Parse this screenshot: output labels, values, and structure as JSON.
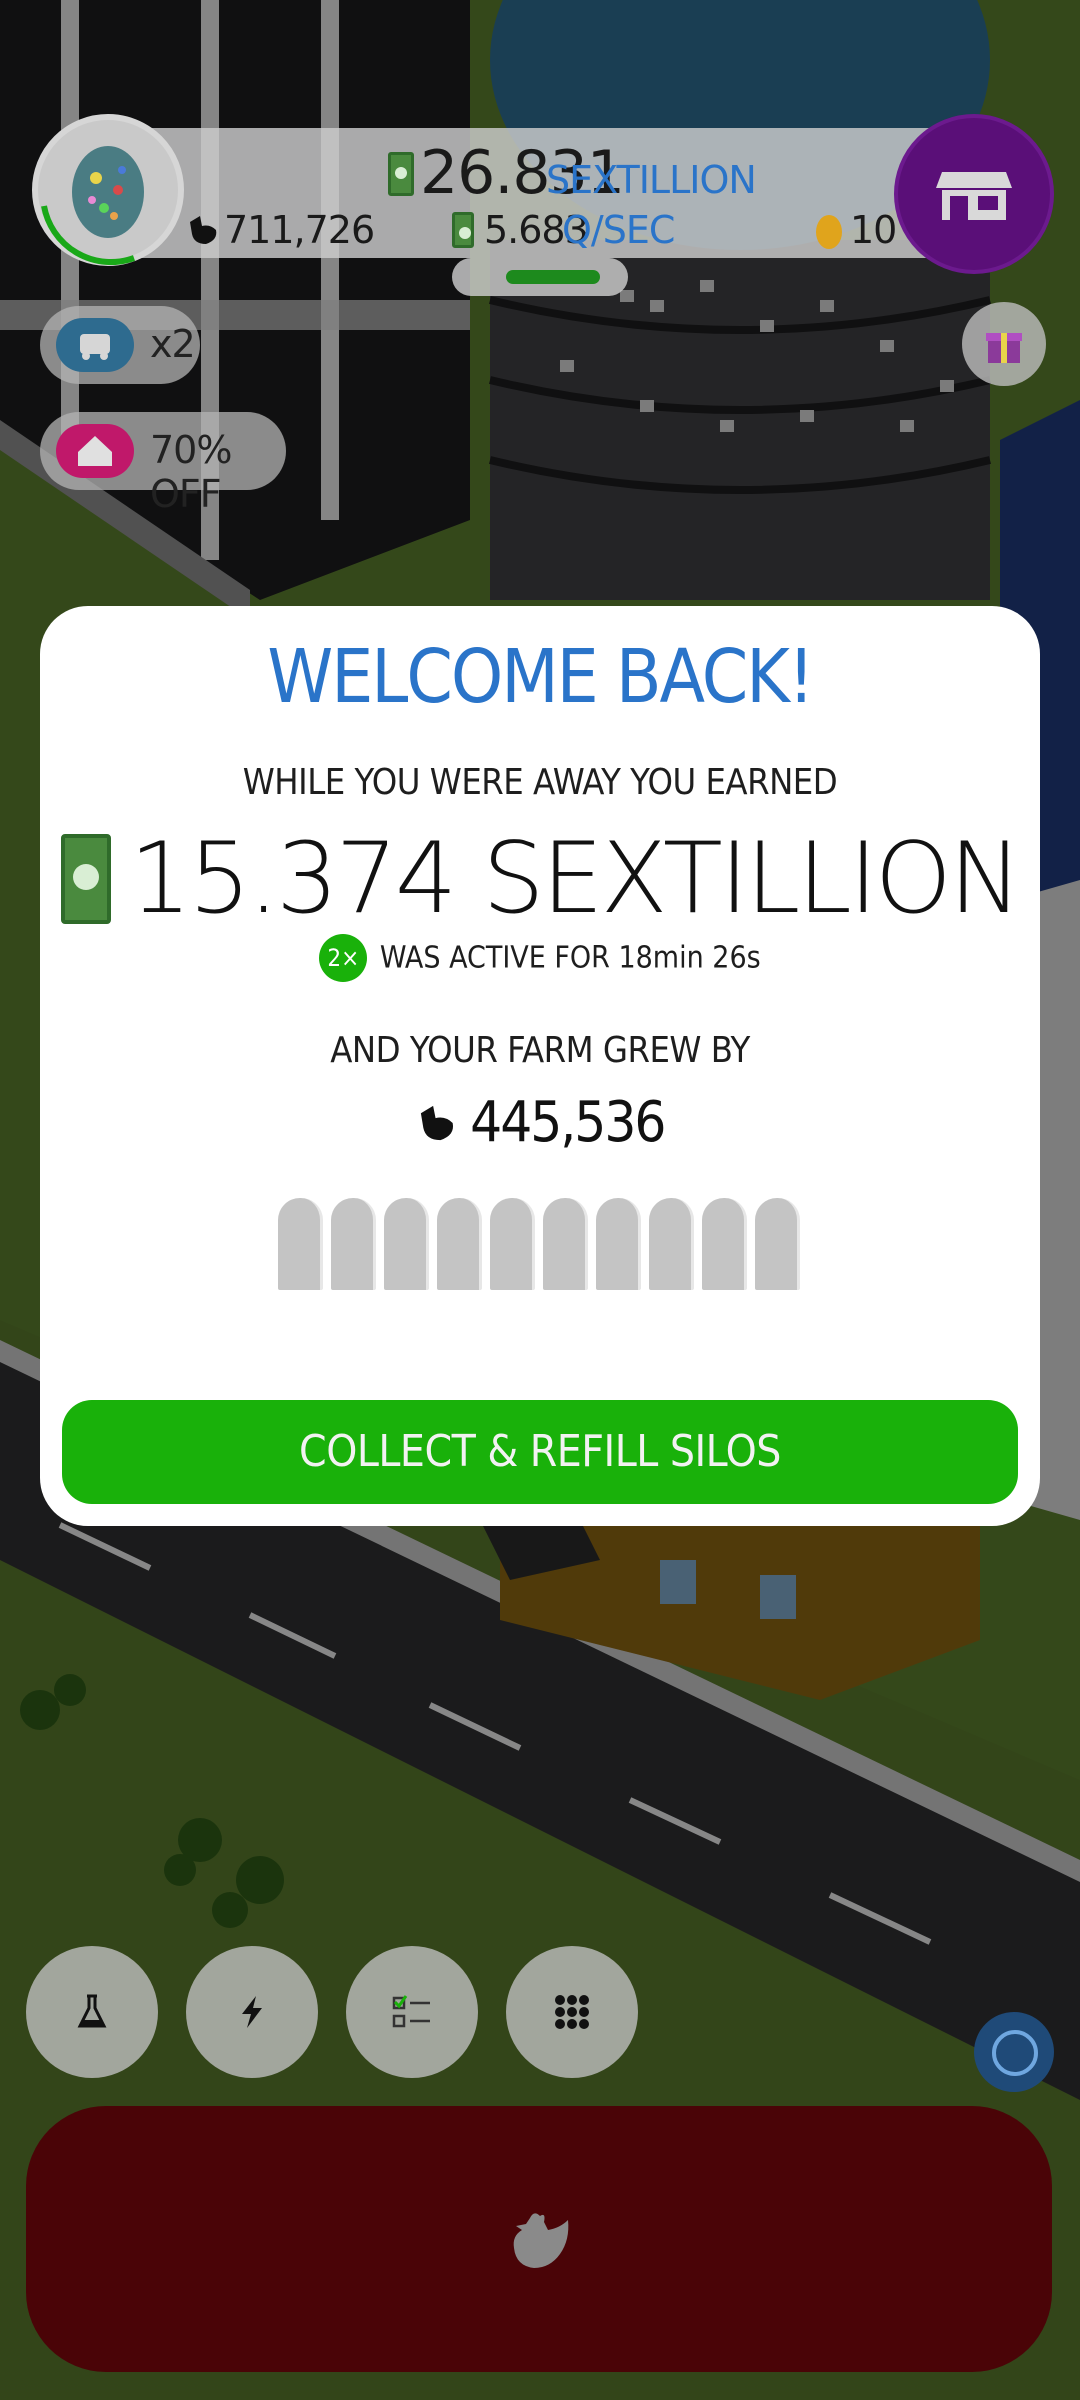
{
  "hud": {
    "money_value": "26.831",
    "money_unit": "SEXTILLION",
    "chicken_count": "711,726",
    "rate_value": "5.683",
    "rate_unit": "Q/SEC",
    "golden_eggs": "10"
  },
  "boosts": {
    "multiplier_label": "x2",
    "discount_label": "70% OFF"
  },
  "modal": {
    "title": "WELCOME BACK!",
    "earned_label": "WHILE YOU WERE AWAY YOU EARNED",
    "earned_amount": "15.374 SEXTILLION",
    "active_badge": "2×",
    "active_text": "WAS ACTIVE FOR 18min 26s",
    "grew_label": "AND YOUR FARM GREW BY",
    "grew_amount": "445,536",
    "silo_count": 10,
    "collect_label": "COLLECT & REFILL SILOS"
  },
  "bottom_menu": {
    "items": [
      "research-icon",
      "boost-icon",
      "missions-icon",
      "menu-grid-icon"
    ]
  },
  "colors": {
    "title_blue": "#2a74c9",
    "collect_green": "#19b10a",
    "shop_purple": "#5a0f78",
    "hatch_red": "#4a0407",
    "silo_gray": "#c4c4c4"
  }
}
